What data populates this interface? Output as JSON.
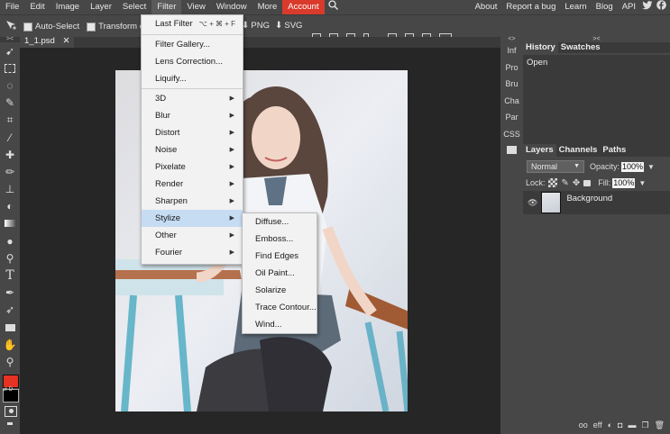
{
  "menubar": {
    "items": [
      "File",
      "Edit",
      "Image",
      "Layer",
      "Select",
      "Filter",
      "View",
      "Window",
      "More",
      "Account"
    ],
    "right": [
      "About",
      "Report a bug",
      "Learn",
      "Blog",
      "API"
    ]
  },
  "toolopts": {
    "auto_select": "Auto-Select",
    "transform": "Transform controls",
    "png": "PNG",
    "svg": "SVG"
  },
  "document": {
    "tab_label": "1_1.psd",
    "close": "✕"
  },
  "minipanel": [
    "Inf",
    "Pro",
    "Bru",
    "Cha",
    "Par",
    "CSS"
  ],
  "history": {
    "tabs": [
      "History",
      "Swatches"
    ],
    "items": [
      "Open"
    ]
  },
  "layers": {
    "tabs": [
      "Layers",
      "Channels",
      "Paths"
    ],
    "blend_mode": "Normal",
    "opacity_label": "Opacity:",
    "opacity_value": "100%",
    "lock_label": "Lock:",
    "fill_label": "Fill:",
    "fill_value": "100%",
    "layer_name": "Background",
    "footer": [
      "oo",
      "eff"
    ]
  },
  "filter_menu": {
    "last_filter": "Last Filter",
    "last_filter_shortcut": "⌥ + ⌘ + F",
    "top_items": [
      "Filter Gallery...",
      "Lens Correction...",
      "Liquify..."
    ],
    "sub_items": [
      "3D",
      "Blur",
      "Distort",
      "Noise",
      "Pixelate",
      "Render",
      "Sharpen",
      "Stylize",
      "Other",
      "Fourier"
    ],
    "highlighted": "Stylize"
  },
  "stylize_submenu": [
    "Diffuse...",
    "Emboss...",
    "Find Edges",
    "Oil Paint...",
    "Solarize",
    "Trace Contour...",
    "Wind..."
  ],
  "colors": {
    "accent": "#d93a2b",
    "foreground": "#e53222",
    "background": "#000000",
    "highlight": "#c6dcf3"
  }
}
